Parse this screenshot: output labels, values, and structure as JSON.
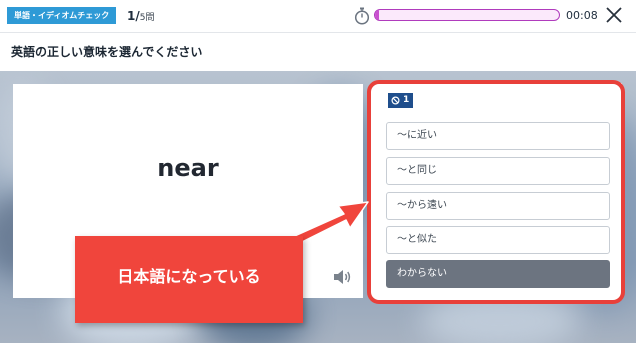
{
  "header": {
    "mode_tag": "単語・イディオムチェック",
    "progress_current": "1/",
    "progress_total": "5問",
    "timer_text": "00:08",
    "timer_progress_fraction": 0.02,
    "timer_color": "#b03bbd"
  },
  "instruction": "英語の正しい意味を選んでください",
  "word": {
    "text": "near",
    "speaker_icon": "speaker-icon"
  },
  "choices_panel": {
    "badge_number": "1",
    "badge_icon": "circle-slash-icon",
    "choices": [
      "～に近い",
      "～と同じ",
      "～から遠い",
      "～と似た"
    ],
    "unknown_label": "わからない"
  },
  "annotation": {
    "callout_text": "日本語になっている",
    "accent_color": "#e8403a"
  }
}
